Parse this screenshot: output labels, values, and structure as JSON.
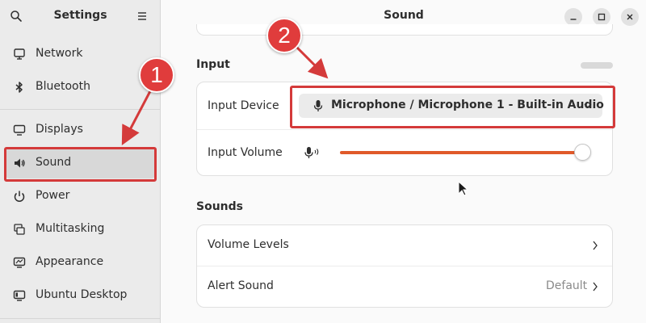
{
  "sidebar": {
    "title": "Settings",
    "items": [
      {
        "label": "Network",
        "icon": "network-icon"
      },
      {
        "label": "Bluetooth",
        "icon": "bluetooth-icon"
      },
      {
        "label": "Displays",
        "icon": "display-icon"
      },
      {
        "label": "Sound",
        "icon": "speaker-icon",
        "active": true
      },
      {
        "label": "Power",
        "icon": "power-icon"
      },
      {
        "label": "Multitasking",
        "icon": "multitasking-icon"
      },
      {
        "label": "Appearance",
        "icon": "appearance-icon"
      },
      {
        "label": "Ubuntu Desktop",
        "icon": "ubuntu-desktop-icon"
      }
    ]
  },
  "main": {
    "title": "Sound",
    "input_section": {
      "title": "Input",
      "input_device_label": "Input Device",
      "input_device_value": "Microphone / Microphone 1 - Built-in Audio",
      "input_volume_label": "Input Volume",
      "input_volume_level": 1.0
    },
    "sounds_section": {
      "title": "Sounds",
      "volume_levels_label": "Volume Levels",
      "alert_sound_label": "Alert Sound",
      "alert_sound_value": "Default"
    }
  },
  "annotations": {
    "badge_1": "1",
    "badge_2": "2",
    "color": "#d43a3a"
  },
  "colors": {
    "accent": "#e05a2a",
    "sidebar_bg": "#ebebeb",
    "active_item_bg": "#d8d8d8"
  }
}
